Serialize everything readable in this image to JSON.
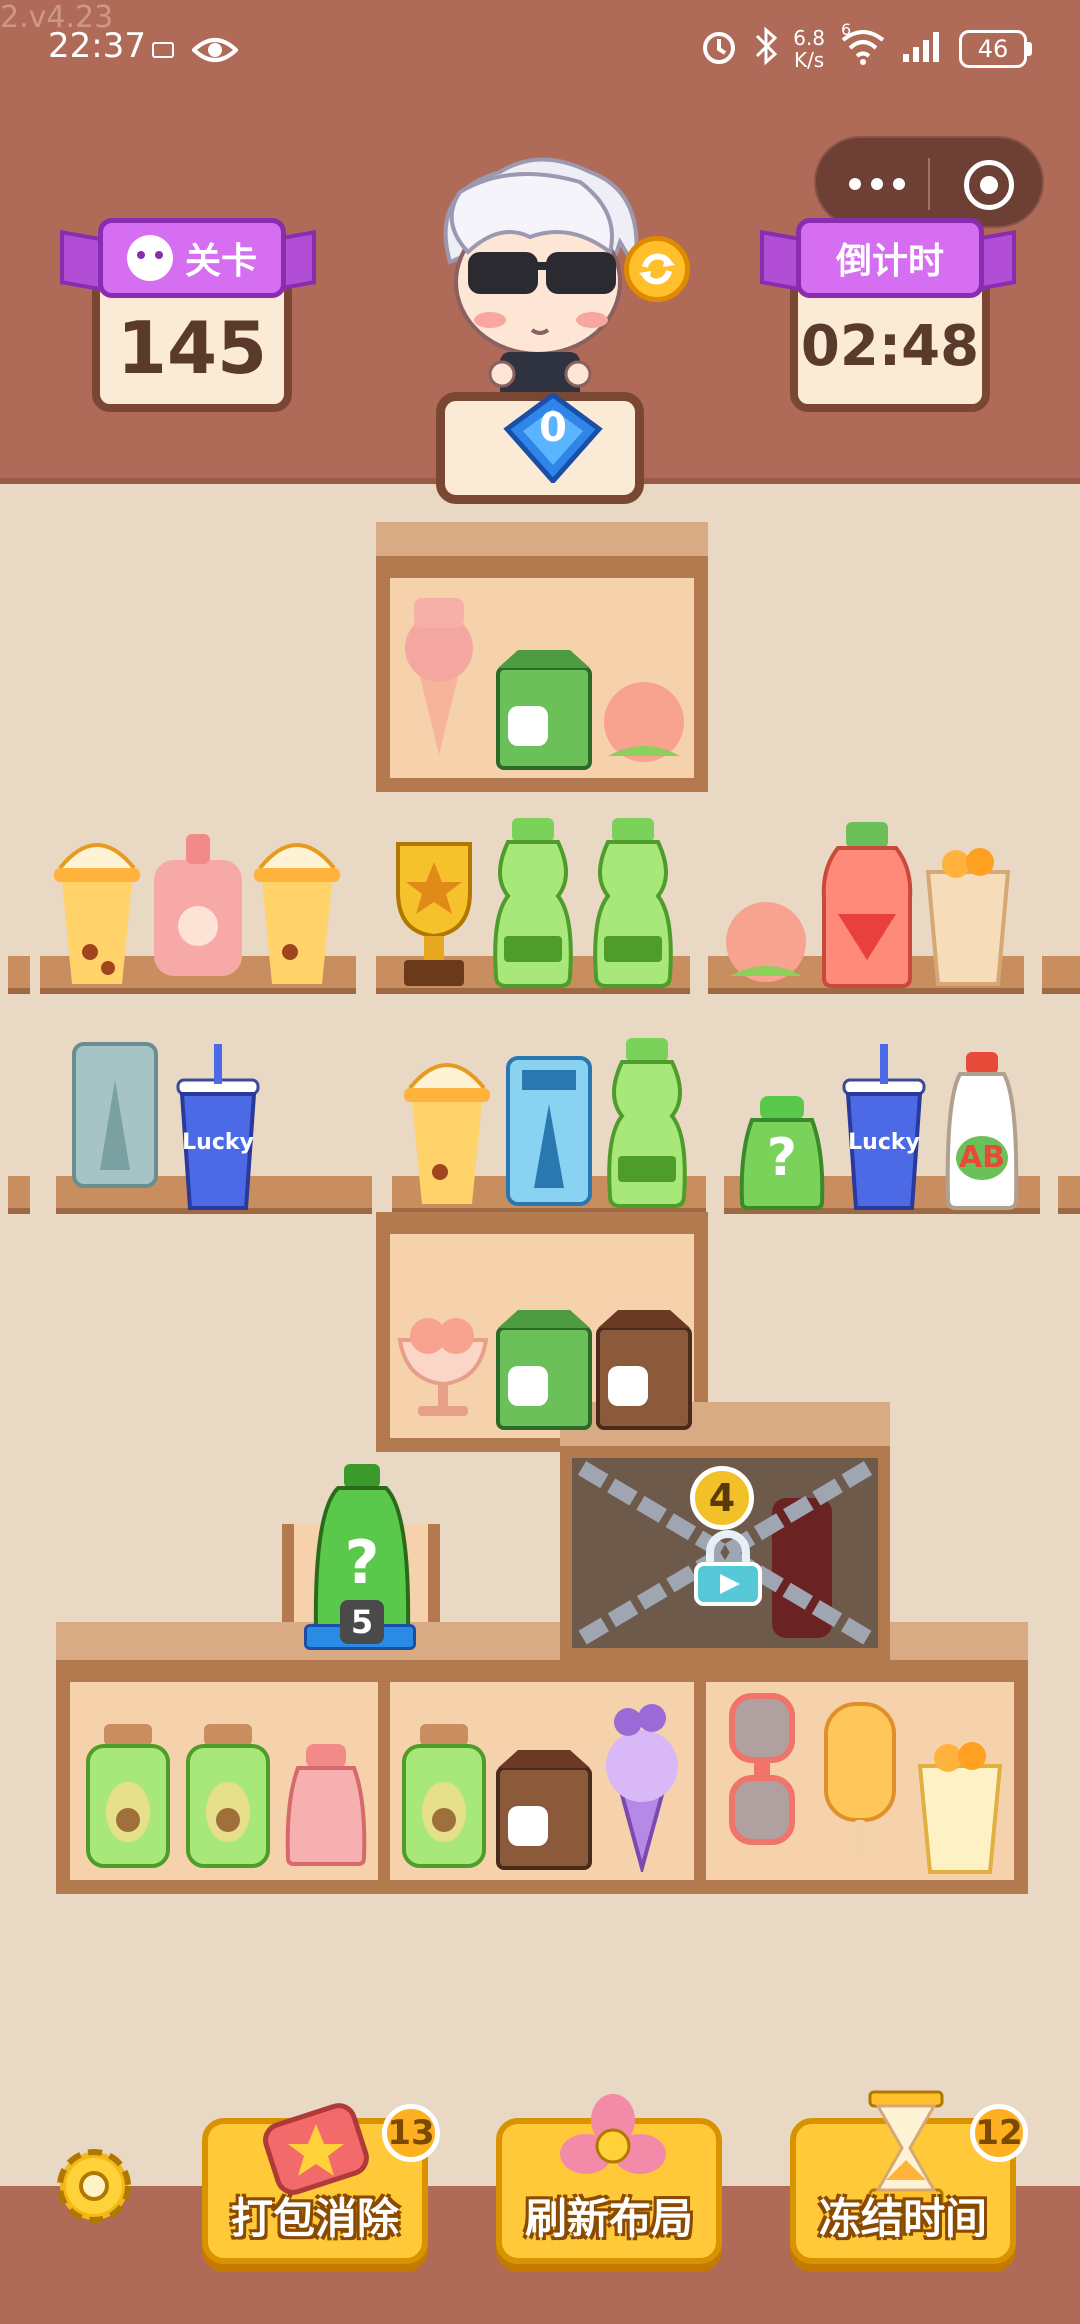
{
  "version": "2.v4.23",
  "status_bar": {
    "time": "22:37",
    "network_speed_value": "6.8",
    "network_speed_unit": "K/s",
    "wifi_label": "6",
    "battery": "46"
  },
  "level_panel": {
    "ribbon_label": "关卡",
    "value": "145"
  },
  "timer_panel": {
    "ribbon_label": "倒计时",
    "value": "02:48"
  },
  "gem_count": "0",
  "items": {
    "lucky_label_1": "Lucky",
    "lucky_label_2": "Lucky",
    "ab_label": "AB",
    "mystery_mark": "?",
    "mystery_bottle_count": "5",
    "locked_box_count": "4"
  },
  "actions": [
    {
      "label": "打包消除",
      "count": "13"
    },
    {
      "label": "刷新布局",
      "count": ""
    },
    {
      "label": "冻结时间",
      "count": "12"
    }
  ]
}
